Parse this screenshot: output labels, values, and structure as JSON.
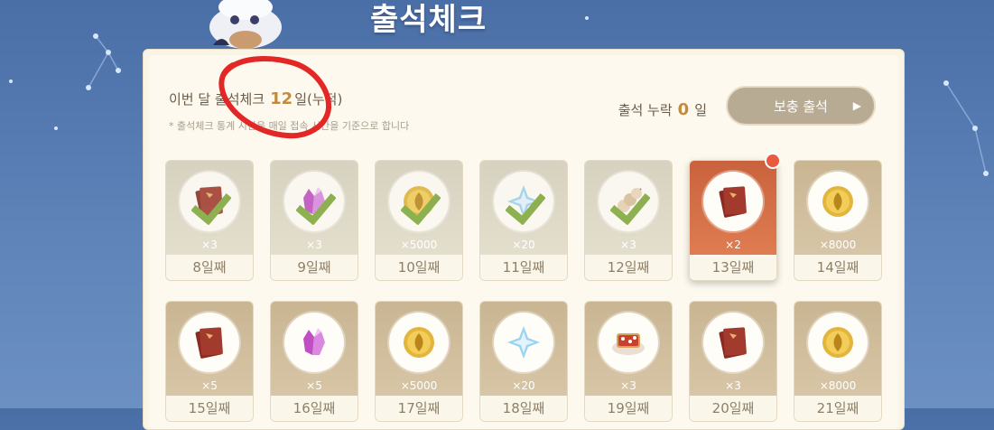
{
  "header": {
    "title": "출석체크"
  },
  "summary": {
    "count_prefix": "이번 달 출석체크",
    "count_value": "12",
    "count_suffix": "일(누적)",
    "note": "* 출석체크 통계 시간은 매일 접속 시간을 기준으로 합니다",
    "missed_prefix": "출석 누락",
    "missed_value": "0",
    "missed_suffix": "일",
    "makeup_button": "보충 출석"
  },
  "colors": {
    "accent": "#c48a3e",
    "today": "#d8704a",
    "check": "#7fa83b",
    "annotation": "#e32626"
  },
  "cards": [
    {
      "day": "8일째",
      "qty": "×3",
      "icon": "hero-wit-book-icon",
      "claimed": true
    },
    {
      "day": "9일째",
      "qty": "×3",
      "icon": "crystal-icon",
      "claimed": true
    },
    {
      "day": "10일째",
      "qty": "×5000",
      "icon": "mora-coin-icon",
      "claimed": true
    },
    {
      "day": "11일째",
      "qty": "×20",
      "icon": "primogem-icon",
      "claimed": true
    },
    {
      "day": "12일째",
      "qty": "×3",
      "icon": "food-skewer-icon",
      "claimed": true
    },
    {
      "day": "13일째",
      "qty": "×2",
      "icon": "hero-wit-book-icon",
      "today": true
    },
    {
      "day": "14일째",
      "qty": "×8000",
      "icon": "mora-coin-icon"
    },
    {
      "day": "15일째",
      "qty": "×5",
      "icon": "hero-wit-book-icon"
    },
    {
      "day": "16일째",
      "qty": "×5",
      "icon": "crystal-icon"
    },
    {
      "day": "17일째",
      "qty": "×5000",
      "icon": "mora-coin-icon"
    },
    {
      "day": "18일째",
      "qty": "×20",
      "icon": "primogem-icon"
    },
    {
      "day": "19일째",
      "qty": "×3",
      "icon": "pizza-dish-icon"
    },
    {
      "day": "20일째",
      "qty": "×3",
      "icon": "hero-wit-book-icon"
    },
    {
      "day": "21일째",
      "qty": "×8000",
      "icon": "mora-coin-icon"
    }
  ]
}
